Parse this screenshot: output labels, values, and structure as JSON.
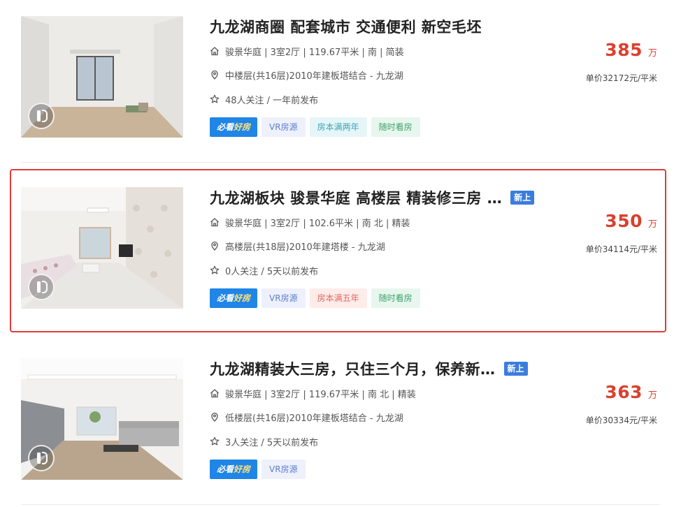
{
  "listings": [
    {
      "title": "九龙湖商圈 配套城市 交通便利 新空毛坯",
      "new_badge": "",
      "house_info": "骏景华庭 | 3室2厅 | 119.67平米 | 南 | 简装",
      "position_info": "中楼层(共16层)2010年建板塔结合 - 九龙湖",
      "follow_info": "48人关注 / 一年前发布",
      "tags": {
        "good_a": "必看",
        "good_b": "好房",
        "vr": "VR房源",
        "tax": "房本满两年",
        "visit": "随时看房"
      },
      "price": "385",
      "price_unit": "万",
      "unit_price": "单价32172元/平米",
      "selected": false
    },
    {
      "title": "九龙湖板块 骏景华庭 高楼层 精装修三房 …",
      "new_badge": "新上",
      "house_info": "骏景华庭 | 3室2厅 | 102.6平米 | 南 北 | 精装",
      "position_info": "高楼层(共18层)2010年建塔楼 - 九龙湖",
      "follow_info": "0人关注 / 5天以前发布",
      "tags": {
        "good_a": "必看",
        "good_b": "好房",
        "vr": "VR房源",
        "tax": "房本满五年",
        "visit": "随时看房"
      },
      "price": "350",
      "price_unit": "万",
      "unit_price": "单价34114元/平米",
      "selected": true
    },
    {
      "title": "九龙湖精装大三房，只住三个月，保养新…",
      "new_badge": "新上",
      "house_info": "骏景华庭 | 3室2厅 | 119.67平米 | 南 北 | 精装",
      "position_info": "低楼层(共16层)2010年建板塔结合 - 九龙湖",
      "follow_info": "3人关注 / 5天以前发布",
      "tags": {
        "good_a": "必看",
        "good_b": "好房",
        "vr": "VR房源"
      },
      "price": "363",
      "price_unit": "万",
      "unit_price": "单价30334元/平米",
      "selected": false
    }
  ],
  "icons": {
    "house": "house-icon",
    "location": "location-pin-icon",
    "follow": "star-icon",
    "vr": "vr-tour-icon"
  },
  "colors": {
    "price": "#d9412e",
    "tag_good": "#1f85e6",
    "new_badge": "#3b7ddd",
    "selected_border": "#e03a3a"
  }
}
